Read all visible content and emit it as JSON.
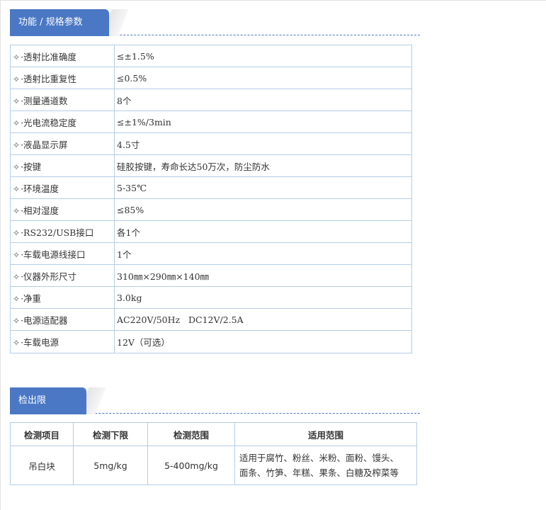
{
  "section_spec": {
    "title": "功能 / 规格参数"
  },
  "spec_rows": [
    {
      "label": "·透射比准确度",
      "value": "≤±1.5%"
    },
    {
      "label": "·透射比重复性",
      "value": "≤0.5%"
    },
    {
      "label": "·测量通道数",
      "value": "8个"
    },
    {
      "label": "·光电流稳定度",
      "value": "≤±1%/3min"
    },
    {
      "label": "·液晶显示屏",
      "value": "4.5寸"
    },
    {
      "label": "·按键",
      "value": "硅胶按键，寿命长达50万次，防尘防水"
    },
    {
      "label": "·环境温度",
      "value": "5-35℃"
    },
    {
      "label": "·相对湿度",
      "value": "≤85%"
    },
    {
      "label": "·RS232/USB接口",
      "value": "各1个"
    },
    {
      "label": "·车载电源线接口",
      "value": "1个"
    },
    {
      "label": "·仪器外形尺寸",
      "value": "310㎜×290㎜×140㎜"
    },
    {
      "label": "·净重",
      "value": "3.0kg"
    },
    {
      "label": "·电源适配器",
      "value": "AC220V/50Hz   DC12V/2.5A"
    },
    {
      "label": "·车载电源",
      "value": "12V（可选）"
    }
  ],
  "row_icon": "diamond-icon",
  "section_limit": {
    "title": "检出限"
  },
  "limit_table": {
    "headers": [
      "检测项目",
      "检测下限",
      "检测范围",
      "适用范围"
    ],
    "rows": [
      {
        "item": "吊白块",
        "lower": "5mg/kg",
        "range": "5-400mg/kg",
        "scope_line1": "适用于腐竹、粉丝、米粉、面粉、馒头、",
        "scope_line2": "面条、竹笋、年糕、果条、白糖及榨菜等"
      }
    ]
  },
  "colors": {
    "accent": "#4a78c4",
    "border": "#b4cde6",
    "text": "#333333"
  }
}
